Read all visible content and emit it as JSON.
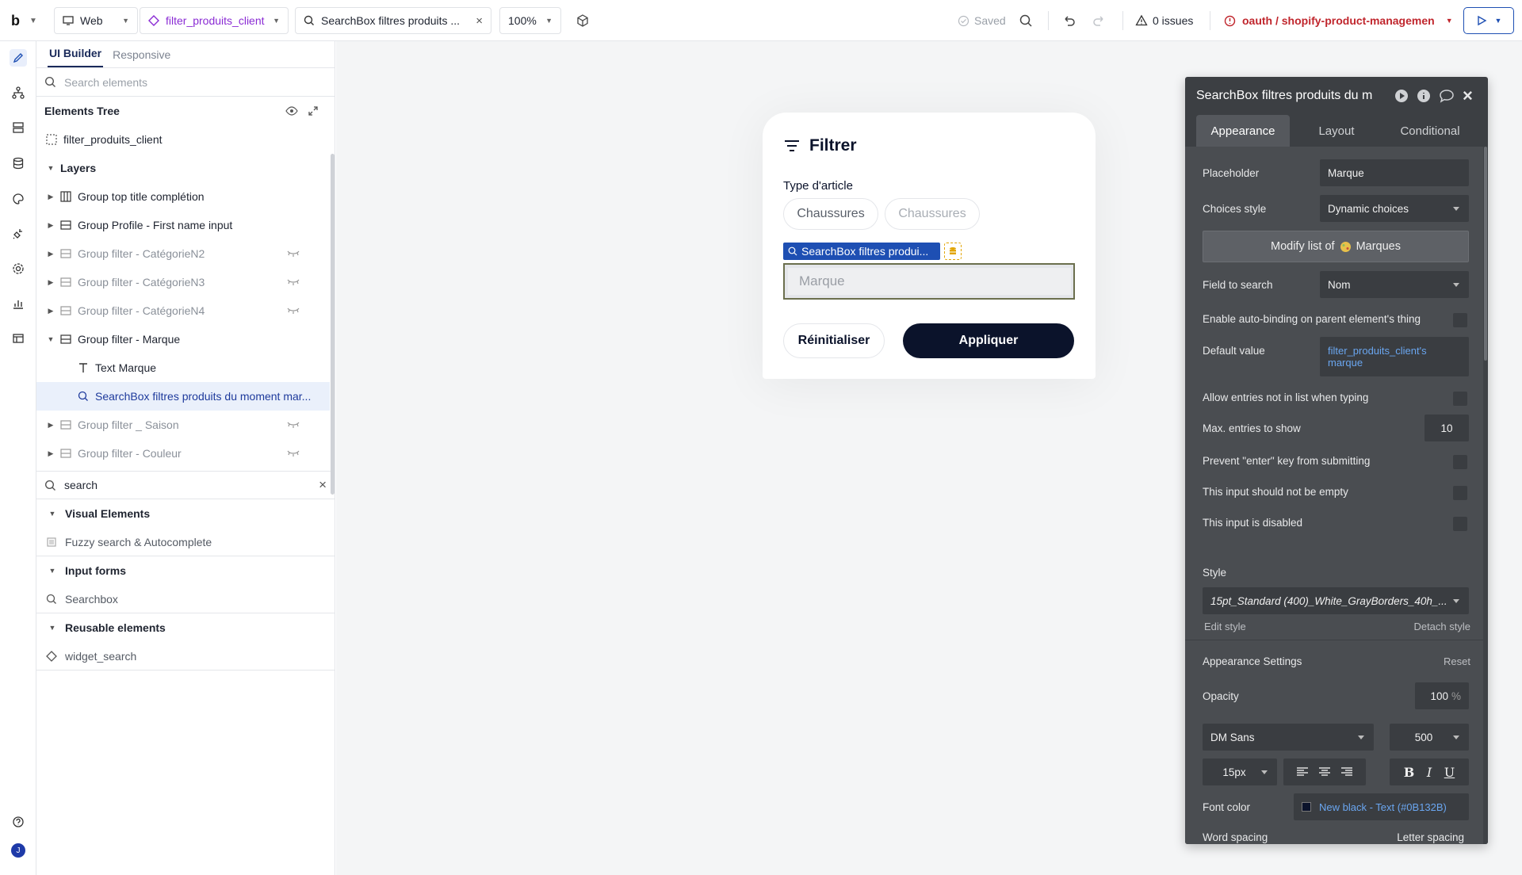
{
  "topbar": {
    "logo": "b",
    "platform": "Web",
    "page_name": "filter_produits_client",
    "element_name": "SearchBox filtres produits ...",
    "zoom": "100%",
    "saved": "Saved",
    "issues": "0 issues",
    "branch": "oauth / shopify-product-managemen"
  },
  "sidebar": {
    "tabs": [
      "UI Builder",
      "Responsive"
    ],
    "search_placeholder": "Search elements",
    "tree_title": "Elements Tree",
    "root": "filter_produits_client",
    "layers_label": "Layers",
    "tree": [
      {
        "label": "Group top title complétion",
        "icon": "column-group-icon"
      },
      {
        "label": "Group Profile - First name input",
        "icon": "row-group-icon"
      },
      {
        "label": "Group filter - CatégorieN2",
        "icon": "row-group-icon",
        "hidden": true
      },
      {
        "label": "Group filter - CatégorieN3",
        "icon": "row-group-icon",
        "hidden": true
      },
      {
        "label": "Group filter - CatégorieN4",
        "icon": "row-group-icon",
        "hidden": true
      },
      {
        "label": "Group filter - Marque",
        "icon": "row-group-icon",
        "expanded": true
      },
      {
        "label": "Text Marque",
        "icon": "text-icon",
        "child": true
      },
      {
        "label": "SearchBox filtres produits du moment mar...",
        "icon": "search-icon",
        "child": true,
        "selected": true
      },
      {
        "label": "Group filter _ Saison",
        "icon": "row-group-icon",
        "hidden": true
      },
      {
        "label": "Group filter - Couleur",
        "icon": "row-group-icon",
        "hidden": true
      }
    ],
    "element_search_value": "search",
    "sections": [
      {
        "title": "Visual Elements",
        "items": [
          "Fuzzy search & Autocomplete"
        ]
      },
      {
        "title": "Input forms",
        "items": [
          "Searchbox"
        ]
      },
      {
        "title": "Reusable elements",
        "items": [
          "widget_search"
        ]
      }
    ]
  },
  "canvas": {
    "card_title": "Filtrer",
    "type_label": "Type d'article",
    "chips": [
      "Chaussures",
      "Chaussures"
    ],
    "element_tag": "SearchBox filtres produi...",
    "search_placeholder": "Marque",
    "reset_button": "Réinitialiser",
    "apply_button": "Appliquer"
  },
  "props": {
    "title": "SearchBox filtres produits du m",
    "tabs": [
      "Appearance",
      "Layout",
      "Conditional"
    ],
    "placeholder_label": "Placeholder",
    "placeholder_value": "Marque",
    "choices_style_label": "Choices style",
    "choices_style_value": "Dynamic choices",
    "modify_list_prefix": "Modify list of",
    "modify_list_suffix": "Marques",
    "field_to_search_label": "Field to search",
    "field_to_search_value": "Nom",
    "auto_binding_label": "Enable auto-binding on parent element's thing",
    "default_value_label": "Default value",
    "default_value_line1": "filter_produits_client's",
    "default_value_line2": "marque",
    "allow_entries_label": "Allow entries not in list when typing",
    "max_entries_label": "Max. entries to show",
    "max_entries_value": "10",
    "prevent_enter_label": "Prevent \"enter\" key from submitting",
    "not_empty_label": "This input should not be empty",
    "disabled_label": "This input is disabled",
    "style_label": "Style",
    "style_value": "15pt_Standard (400)_White_GrayBorders_40h_...",
    "edit_style": "Edit style",
    "detach_style": "Detach style",
    "appearance_settings": "Appearance Settings",
    "reset": "Reset",
    "opacity_label": "Opacity",
    "opacity_value": "100",
    "opacity_unit": "%",
    "font_value": "DM Sans",
    "weight_value": "500",
    "size_value": "15px",
    "font_color_label": "Font color",
    "font_color_value": "New black - Text (#0B132B)",
    "font_color_hex": "#0B132B",
    "word_spacing": "Word spacing",
    "letter_spacing": "Letter spacing"
  }
}
